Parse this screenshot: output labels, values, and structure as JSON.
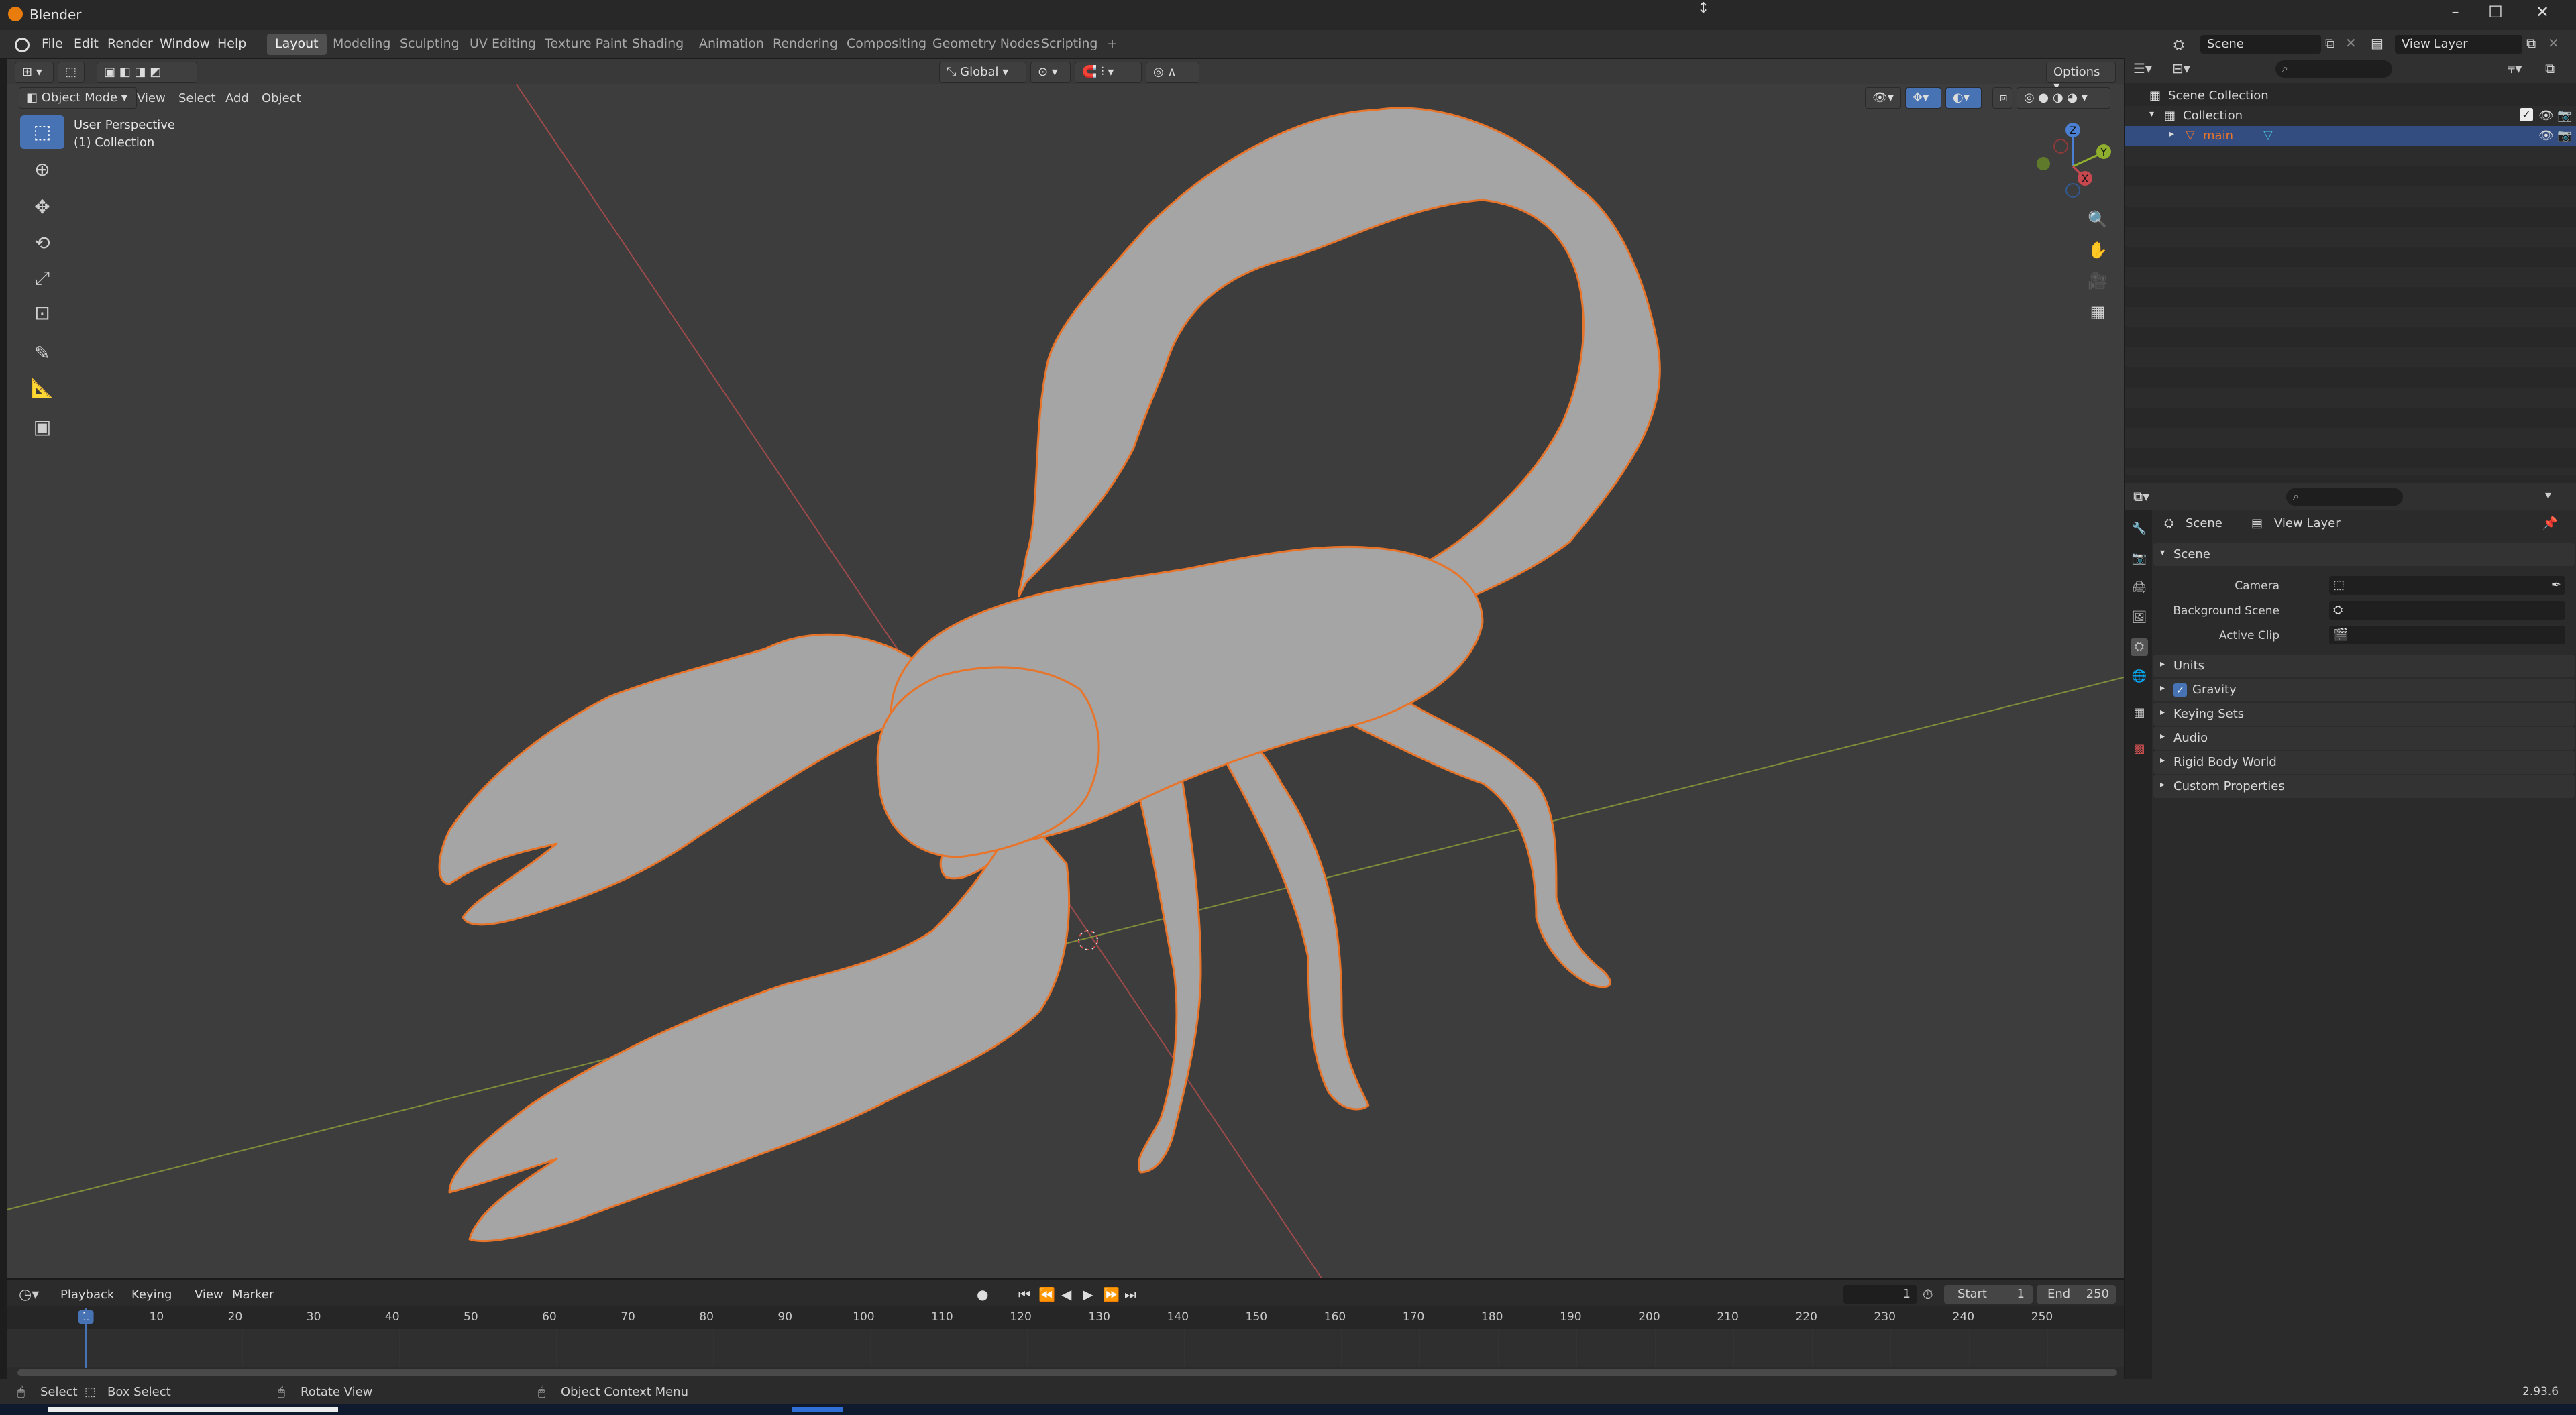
{
  "window": {
    "title": "Blender"
  },
  "menubar": {
    "items": [
      "File",
      "Edit",
      "Render",
      "Window",
      "Help"
    ],
    "workspaces": [
      "Layout",
      "Modeling",
      "Sculpting",
      "UV Editing",
      "Texture Paint",
      "Shading",
      "Animation",
      "Rendering",
      "Compositing",
      "Geometry Nodes",
      "Scripting"
    ],
    "active_workspace": "Layout",
    "add_workspace": "+",
    "scene_name": "Scene",
    "view_layer_name": "View Layer"
  },
  "viewport": {
    "transform_orientation": "Global",
    "options_label": "Options",
    "mode": "Object Mode",
    "menus": [
      "View",
      "Select",
      "Add",
      "Object"
    ],
    "overlay_title": "User Perspective",
    "overlay_collection": "(1) Collection",
    "gizmo_axes": [
      "Z",
      "Y",
      "X"
    ]
  },
  "timeline": {
    "menus": [
      "Playback",
      "Keying",
      "View",
      "Marker"
    ],
    "current_frame": "1",
    "start_label": "Start",
    "start_value": "1",
    "end_label": "End",
    "end_value": "250",
    "ticks": [
      "1",
      "10",
      "20",
      "30",
      "40",
      "50",
      "60",
      "70",
      "80",
      "90",
      "100",
      "110",
      "120",
      "130",
      "140",
      "150",
      "160",
      "170",
      "180",
      "190",
      "200",
      "210",
      "220",
      "230",
      "240",
      "250"
    ],
    "current_frame_progress": 0
  },
  "statusbar": {
    "select": "Select",
    "box_select": "Box Select",
    "rotate_view": "Rotate View",
    "object_context_menu": "Object Context Menu",
    "version": "2.93.6"
  },
  "outliner": {
    "scene_collection": "Scene Collection",
    "collection": "Collection",
    "object": "main"
  },
  "properties": {
    "breadcrumb_scene": "Scene",
    "breadcrumb_view_layer": "View Layer",
    "section_scene": "Scene",
    "camera_label": "Camera",
    "background_scene_label": "Background Scene",
    "active_clip_label": "Active Clip",
    "panels": [
      "Units",
      "Gravity",
      "Keying Sets",
      "Audio",
      "Rigid Body World",
      "Custom Properties"
    ],
    "gravity_checked": true
  },
  "colors": {
    "accent": "#4772b3",
    "selection_outline": "#e8742a",
    "viewport_bg": "#3d3d3d",
    "x_axis": "#c8484f",
    "y_axis": "#8fae2e",
    "z_axis": "#4a7fd4"
  }
}
